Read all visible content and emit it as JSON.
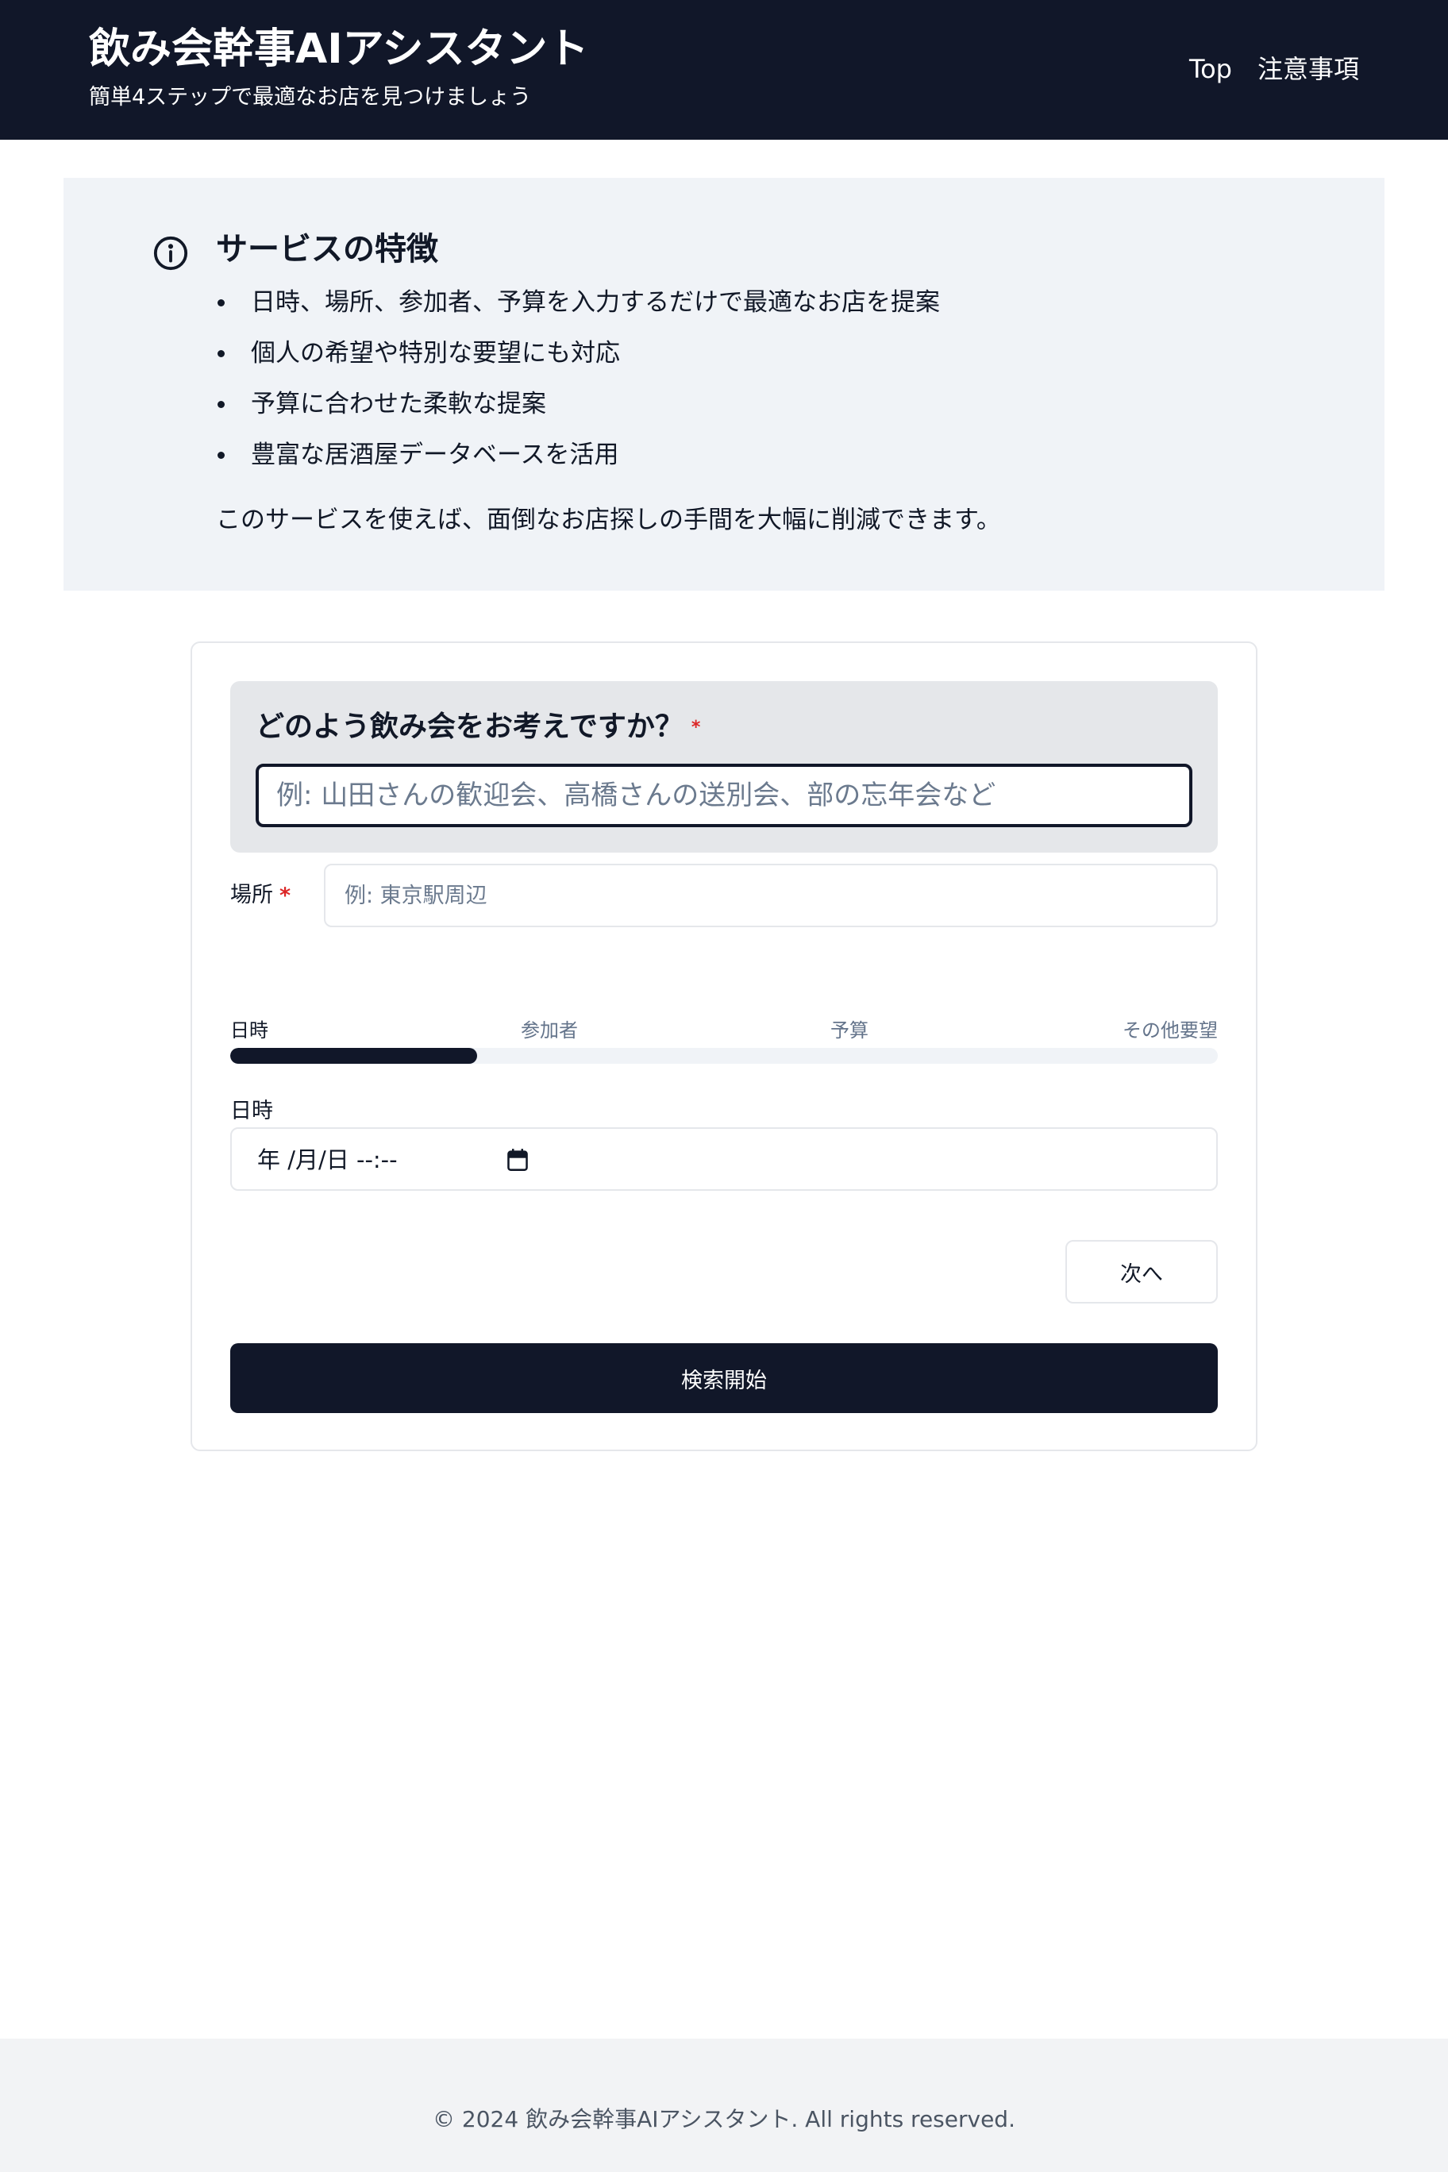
{
  "header": {
    "title": "飲み会幹事AIアシスタント",
    "subtitle": "簡単4ステップで最適なお店を見つけましょう",
    "nav": [
      "Top",
      "注意事項"
    ]
  },
  "info": {
    "icon": "info-icon",
    "title": "サービスの特徴",
    "features": [
      "日時、場所、参加者、予算を入力するだけで最適なお店を提案",
      "個人の希望や特別な要望にも対応",
      "予算に合わせた柔軟な提案",
      "豊富な居酒屋データベースを活用"
    ],
    "note": "このサービスを使えば、面倒なお店探しの手間を大幅に削減できます。"
  },
  "form": {
    "question_label": "どのよう飲み会をお考えですか？",
    "required_mark": "*",
    "question_placeholder": "例: 山田さんの歓迎会、高橋さんの送別会、部の忘年会など",
    "location_label": "場所",
    "location_placeholder": "例: 東京駅周辺",
    "steps": [
      "日時",
      "参加者",
      "予算",
      "その他要望"
    ],
    "current_step": 1,
    "progress_fraction": 0.25,
    "datetime_label": "日時",
    "datetime_value": "年 /月/日 --:--",
    "next_button": "次へ",
    "search_button": "検索開始"
  },
  "footer": {
    "copyright": "© 2024 飲み会幹事AIアシスタント. All rights reserved."
  },
  "colors": {
    "header_bg": "#111729",
    "primary": "#111729",
    "panel_bg": "#f0f3f7",
    "required": "#dc2626",
    "footer_bg": "#f2f3f5"
  }
}
